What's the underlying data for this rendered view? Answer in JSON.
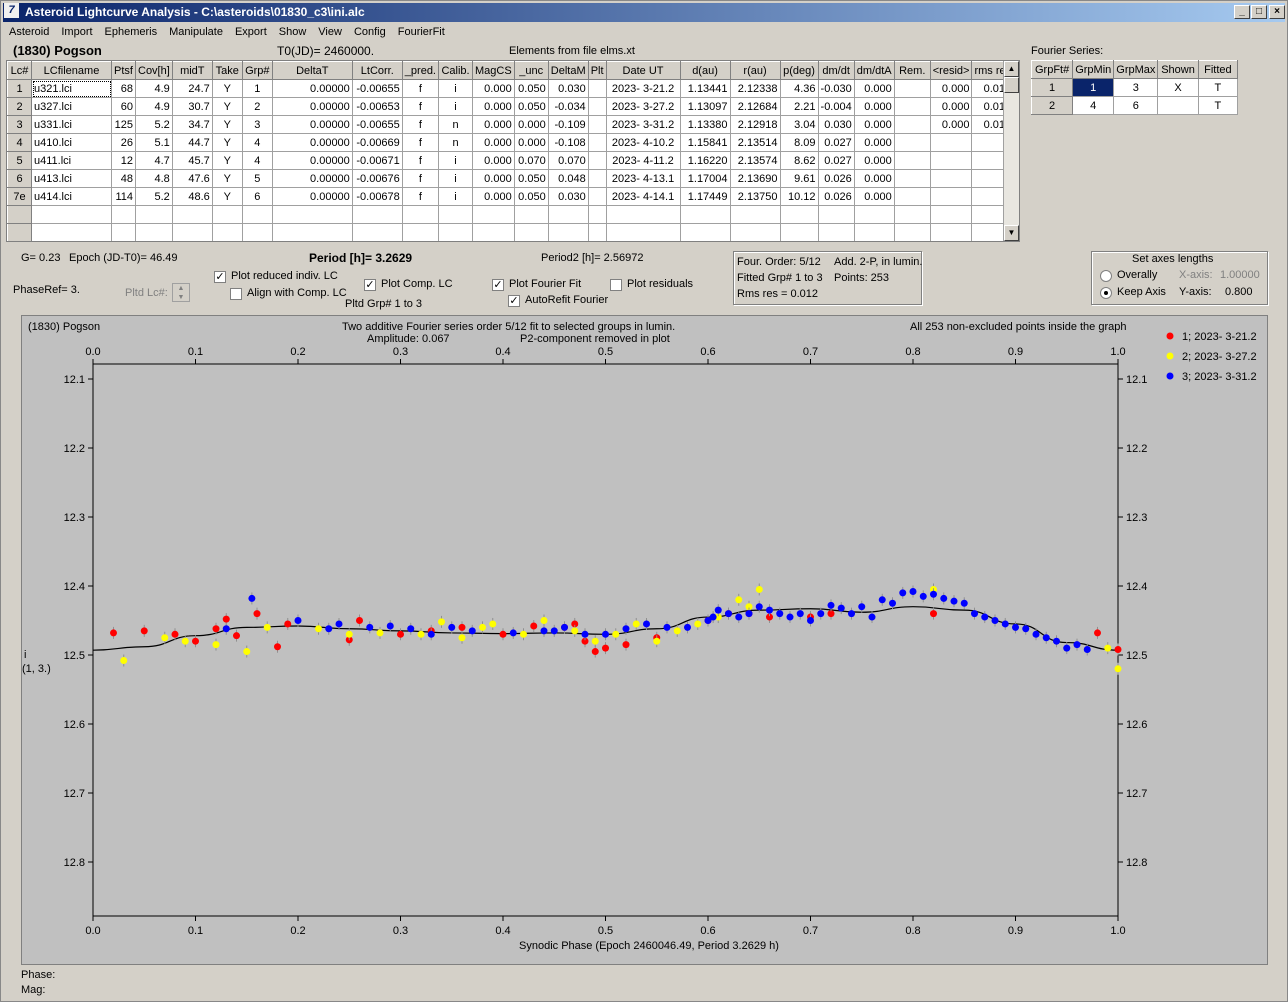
{
  "window": {
    "title": "Asteroid Lightcurve Analysis - C:\\asteroids\\01830_c3\\ini.alc",
    "icon": "app-icon"
  },
  "menu": [
    "Asteroid",
    "Import",
    "Ephemeris",
    "Manipulate",
    "Export",
    "Show",
    "View",
    "Config",
    "FourierFit"
  ],
  "header": {
    "asteroid": "(1830) Pogson",
    "t0": "T0(JD)= 2460000.",
    "elements": "Elements from file elms.xt"
  },
  "lc_table": {
    "columns": [
      "Lc#",
      "LCfilename",
      "Ptsf",
      "Cov[h]",
      "midT",
      "Take",
      "Grp#",
      "DeltaT",
      "LtCorr.",
      "_pred.",
      "Calib.",
      "MagCS",
      "_unc",
      "DeltaM",
      "Plt",
      "Date UT",
      "d(au)",
      "r(au)",
      "p(deg)",
      "dm/dt",
      "dm/dtA",
      "Rem.",
      "<resid>",
      "rms res"
    ],
    "rows": [
      [
        "1",
        "u321.lci",
        "68",
        "4.9",
        "24.7",
        "Y",
        "1",
        "0.00000",
        "-0.00655",
        "f",
        "i",
        "0.000",
        "0.050",
        "0.030",
        "",
        "2023- 3-21.2",
        "1.13441",
        "2.12338",
        "4.36",
        "-0.030",
        "0.000",
        "",
        "0.000",
        "0.012"
      ],
      [
        "2",
        "u327.lci",
        "60",
        "4.9",
        "30.7",
        "Y",
        "2",
        "0.00000",
        "-0.00653",
        "f",
        "i",
        "0.000",
        "0.050",
        "-0.034",
        "",
        "2023- 3-27.2",
        "1.13097",
        "2.12684",
        "2.21",
        "-0.004",
        "0.000",
        "",
        "0.000",
        "0.012"
      ],
      [
        "3",
        "u331.lci",
        "125",
        "5.2",
        "34.7",
        "Y",
        "3",
        "0.00000",
        "-0.00655",
        "f",
        "n",
        "0.000",
        "0.000",
        "-0.109",
        "",
        "2023- 3-31.2",
        "1.13380",
        "2.12918",
        "3.04",
        "0.030",
        "0.000",
        "",
        "0.000",
        "0.010"
      ],
      [
        "4",
        "u410.lci",
        "26",
        "5.1",
        "44.7",
        "Y",
        "4",
        "0.00000",
        "-0.00669",
        "f",
        "n",
        "0.000",
        "0.000",
        "-0.108",
        "",
        "2023- 4-10.2",
        "1.15841",
        "2.13514",
        "8.09",
        "0.027",
        "0.000",
        "",
        "",
        ""
      ],
      [
        "5",
        "u411.lci",
        "12",
        "4.7",
        "45.7",
        "Y",
        "4",
        "0.00000",
        "-0.00671",
        "f",
        "i",
        "0.000",
        "0.070",
        "0.070",
        "",
        "2023- 4-11.2",
        "1.16220",
        "2.13574",
        "8.62",
        "0.027",
        "0.000",
        "",
        "",
        ""
      ],
      [
        "6",
        "u413.lci",
        "48",
        "4.8",
        "47.6",
        "Y",
        "5",
        "0.00000",
        "-0.00676",
        "f",
        "i",
        "0.000",
        "0.050",
        "0.048",
        "",
        "2023- 4-13.1",
        "1.17004",
        "2.13690",
        "9.61",
        "0.026",
        "0.000",
        "",
        "",
        ""
      ],
      [
        "7e",
        "u414.lci",
        "114",
        "5.2",
        "48.6",
        "Y",
        "6",
        "0.00000",
        "-0.00678",
        "f",
        "i",
        "0.000",
        "0.050",
        "0.030",
        "",
        "2023- 4-14.1",
        "1.17449",
        "2.13750",
        "10.12",
        "0.026",
        "0.000",
        "",
        "",
        ""
      ]
    ]
  },
  "fourier_series": {
    "title": "Fourier Series:",
    "columns": [
      "GrpFt#",
      "GrpMin",
      "GrpMax",
      "Shown",
      "Fitted"
    ],
    "rows": [
      [
        "1",
        "1",
        "3",
        "X",
        "T"
      ],
      [
        "2",
        "4",
        "6",
        "",
        "T"
      ]
    ]
  },
  "params": {
    "g": "G= 0.23",
    "epoch": "Epoch (JD-T0)= 46.49",
    "period": "Period [h]= 3.2629",
    "period2": "Period2 [h]= 2.56972",
    "phaseref": "PhaseRef= 3.",
    "pltd_lc": "Pltd Lc#:",
    "pltd_grp": "Pltd Grp#  1   to    3"
  },
  "checks": {
    "plot_reduced": "Plot reduced indiv. LC",
    "align_comp": "Align with Comp. LC",
    "plot_comp": "Plot Comp. LC",
    "plot_fourier": "Plot Fourier Fit",
    "autorefit": "AutoRefit Fourier",
    "plot_resid": "Plot residuals"
  },
  "fourier_info": {
    "order": "Four. Order:  5/12",
    "add": "Add. 2-P, in lumin.",
    "fitted": "Fitted Grp# 1 to 3",
    "points": "Points: 253",
    "rms": "Rms res      = 0.012"
  },
  "axes_box": {
    "title": "Set axes lengths",
    "overally": "Overally",
    "keep": "Keep Axis",
    "xaxis_lbl": "X-axis:",
    "xaxis_val": "1.00000",
    "yaxis_lbl": "Y-axis:",
    "yaxis_val": "0.800"
  },
  "plot_text": {
    "name": "(1830) Pogson",
    "desc1": "Two additive Fourier series order 5/12 fit to selected groups in lumin.",
    "desc2": "Amplitude: 0.067",
    "desc3": "P2-component removed in plot",
    "allpts": "All 253 non-excluded points inside the graph",
    "ylab1": "i",
    "ylab2": "(1, 3.)"
  },
  "status": {
    "phase": "Phase:",
    "mag": "Mag:"
  },
  "colors": {
    "red": "#ff0000",
    "yellow": "#ffff00",
    "blue": "#0000ff"
  },
  "chart_data": {
    "type": "scatter",
    "xlabel": "Synodic Phase (Epoch 2460046.49, Period 3.2629 h)",
    "ylabel": "i",
    "xlim": [
      0,
      1
    ],
    "ylim": [
      12.8,
      12.1
    ],
    "xticks": [
      "0.0",
      "0.1",
      "0.2",
      "0.3",
      "0.4",
      "0.5",
      "0.6",
      "0.7",
      "0.8",
      "0.9",
      "1.0"
    ],
    "yticks": [
      "12.1",
      "12.2",
      "12.3",
      "12.4",
      "12.5",
      "12.6",
      "12.7",
      "12.8"
    ],
    "legend": [
      "1; 2023- 3-21.2",
      "2; 2023- 3-27.2",
      "3; 2023- 3-31.2"
    ],
    "fit": {
      "x": [
        0,
        0.05,
        0.1,
        0.15,
        0.2,
        0.25,
        0.3,
        0.35,
        0.4,
        0.45,
        0.5,
        0.55,
        0.6,
        0.65,
        0.7,
        0.75,
        0.8,
        0.85,
        0.9,
        0.95,
        1.0
      ],
      "y": [
        12.493,
        12.488,
        12.472,
        12.46,
        12.458,
        12.462,
        12.465,
        12.468,
        12.469,
        12.468,
        12.47,
        12.462,
        12.445,
        12.435,
        12.433,
        12.438,
        12.43,
        12.435,
        12.455,
        12.482,
        12.493
      ]
    },
    "series": [
      {
        "name": "1; 2023- 3-21.2",
        "x": [
          0.02,
          0.05,
          0.08,
          0.1,
          0.12,
          0.13,
          0.14,
          0.16,
          0.18,
          0.19,
          0.25,
          0.26,
          0.3,
          0.33,
          0.36,
          0.4,
          0.43,
          0.46,
          0.47,
          0.48,
          0.49,
          0.5,
          0.52,
          0.55,
          0.6,
          0.62,
          0.64,
          0.66,
          0.7,
          0.72,
          0.82,
          0.98,
          1.0
        ],
        "y": [
          12.468,
          12.465,
          12.47,
          12.48,
          12.462,
          12.448,
          12.472,
          12.44,
          12.488,
          12.455,
          12.478,
          12.45,
          12.47,
          12.465,
          12.46,
          12.47,
          12.458,
          12.46,
          12.455,
          12.48,
          12.495,
          12.49,
          12.485,
          12.475,
          12.45,
          12.44,
          12.44,
          12.445,
          12.445,
          12.44,
          12.44,
          12.468,
          12.492
        ]
      },
      {
        "name": "2; 2023- 3-27.2",
        "x": [
          0.03,
          0.07,
          0.09,
          0.12,
          0.15,
          0.17,
          0.22,
          0.25,
          0.28,
          0.32,
          0.34,
          0.36,
          0.38,
          0.39,
          0.42,
          0.44,
          0.47,
          0.49,
          0.51,
          0.53,
          0.55,
          0.57,
          0.59,
          0.61,
          0.63,
          0.64,
          0.65,
          0.82,
          0.99,
          1.0
        ],
        "y": [
          12.508,
          12.475,
          12.48,
          12.485,
          12.495,
          12.46,
          12.462,
          12.47,
          12.468,
          12.47,
          12.452,
          12.475,
          12.46,
          12.455,
          12.47,
          12.45,
          12.465,
          12.48,
          12.47,
          12.455,
          12.48,
          12.465,
          12.455,
          12.445,
          12.42,
          12.43,
          12.405,
          12.405,
          12.49,
          12.52
        ]
      },
      {
        "name": "3; 2023- 3-31.2",
        "x": [
          0.13,
          0.155,
          0.2,
          0.23,
          0.24,
          0.27,
          0.29,
          0.31,
          0.33,
          0.35,
          0.37,
          0.41,
          0.44,
          0.45,
          0.46,
          0.48,
          0.5,
          0.52,
          0.54,
          0.56,
          0.58,
          0.6,
          0.605,
          0.61,
          0.62,
          0.63,
          0.64,
          0.65,
          0.66,
          0.67,
          0.68,
          0.69,
          0.7,
          0.71,
          0.72,
          0.73,
          0.74,
          0.75,
          0.76,
          0.77,
          0.78,
          0.79,
          0.8,
          0.81,
          0.82,
          0.83,
          0.84,
          0.85,
          0.86,
          0.87,
          0.88,
          0.89,
          0.9,
          0.91,
          0.92,
          0.93,
          0.94,
          0.95,
          0.96,
          0.97
        ],
        "y": [
          12.462,
          12.418,
          12.45,
          12.462,
          12.455,
          12.46,
          12.458,
          12.462,
          12.47,
          12.46,
          12.465,
          12.468,
          12.465,
          12.465,
          12.46,
          12.47,
          12.47,
          12.462,
          12.455,
          12.46,
          12.46,
          12.45,
          12.445,
          12.435,
          12.44,
          12.445,
          12.44,
          12.43,
          12.435,
          12.44,
          12.445,
          12.44,
          12.45,
          12.44,
          12.428,
          12.432,
          12.44,
          12.43,
          12.445,
          12.42,
          12.425,
          12.41,
          12.408,
          12.415,
          12.412,
          12.418,
          12.422,
          12.425,
          12.44,
          12.445,
          12.45,
          12.455,
          12.46,
          12.462,
          12.47,
          12.475,
          12.48,
          12.49,
          12.485,
          12.492
        ]
      }
    ]
  }
}
